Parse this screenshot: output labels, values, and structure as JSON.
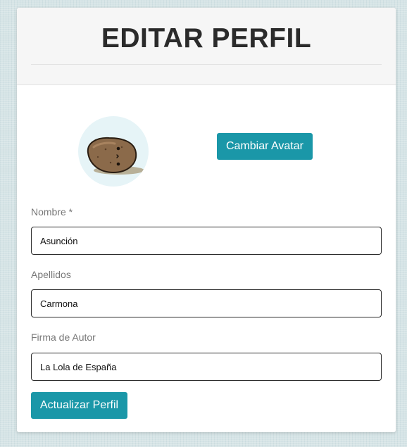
{
  "page": {
    "title": "EDITAR PERFIL"
  },
  "avatar": {
    "icon": "potato-avatar-icon",
    "background_color": "#e6f4f7",
    "change_button_label": "Cambiar Avatar"
  },
  "form": {
    "nombre": {
      "label": "Nombre *",
      "value": "Asunción"
    },
    "apellidos": {
      "label": "Apellidos",
      "value": "Carmona"
    },
    "firma": {
      "label": "Firma de Autor",
      "value": "La Lola de España"
    },
    "submit_label": "Actualizar Perfil"
  },
  "colors": {
    "accent": "#1a97a8",
    "title_text": "#2b2b2b",
    "label_text": "#777777",
    "page_background": "#d6e4e6"
  }
}
